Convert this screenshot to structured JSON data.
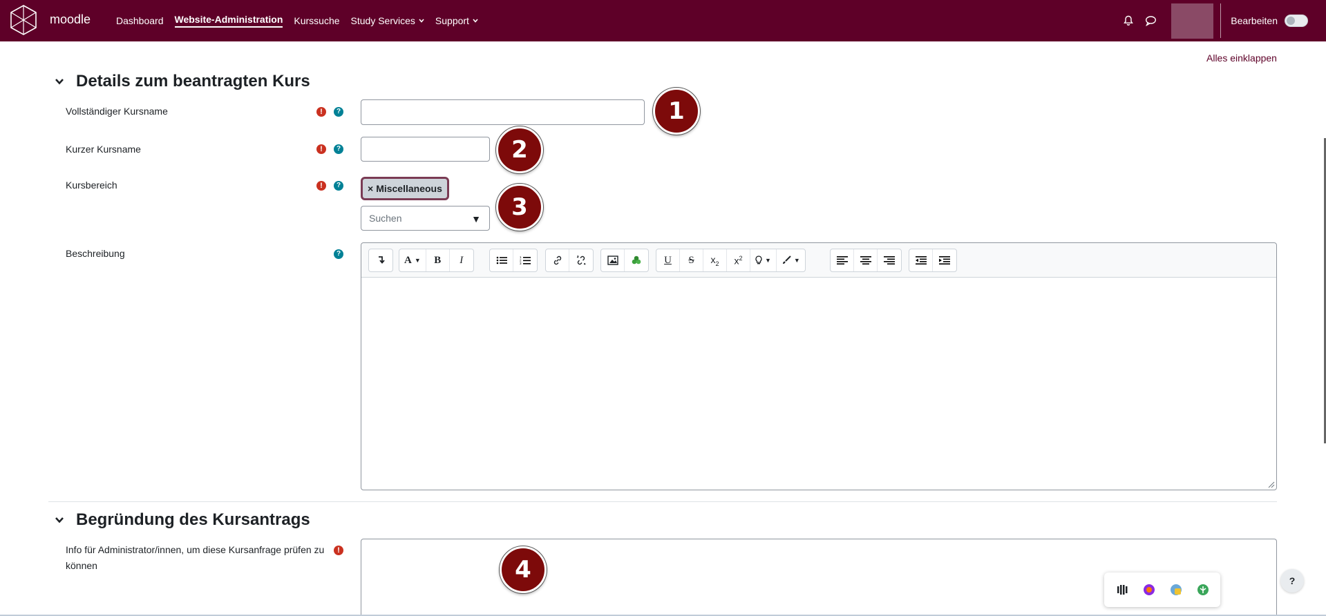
{
  "navbar": {
    "brand": "moodle",
    "links": [
      {
        "label": "Dashboard"
      },
      {
        "label": "Website-Administration"
      },
      {
        "label": "Kurssuche"
      },
      {
        "label": "Study Services"
      },
      {
        "label": "Support"
      }
    ],
    "edit_mode_label": "Bearbeiten",
    "bg_color": "#5e0028"
  },
  "page": {
    "collapse_all": "Alles einklappen"
  },
  "sections": [
    {
      "title": "Details zum beantragten Kurs",
      "fields": {
        "fullname": {
          "label": "Vollständiger Kursname",
          "value": ""
        },
        "shortname": {
          "label": "Kurzer Kursname",
          "value": ""
        },
        "category": {
          "label": "Kursbereich",
          "selected_chip": "Miscellaneous",
          "chip_prefix": "×",
          "search_placeholder": "Suchen",
          "arrow": "▼"
        },
        "description": {
          "label": "Beschreibung"
        }
      }
    },
    {
      "title": "Begründung des Kursantrags",
      "fields": {
        "reason": {
          "label": "Info für Administrator/innen, um diese Kursanfrage prüfen zu können"
        }
      }
    }
  ],
  "icons": {
    "required": "!",
    "help": "?"
  },
  "badges": [
    "1",
    "2",
    "3",
    "4"
  ],
  "help_fab": "?",
  "colors": {
    "accent": "#5e0028",
    "required": "#ca3120",
    "help": "#008196",
    "badge": "#7d0a0a"
  }
}
